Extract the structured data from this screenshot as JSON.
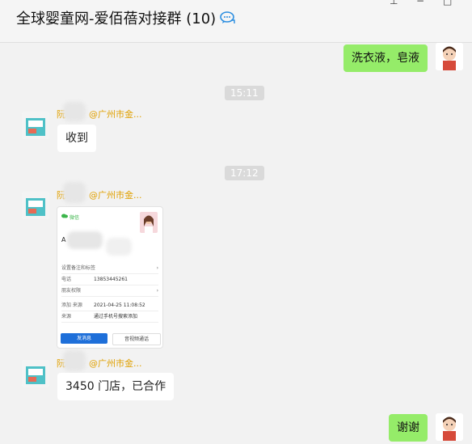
{
  "header": {
    "title": "全球婴童网-爱佰蓓对接群 (10)"
  },
  "window": {
    "pin": "⊥",
    "minimize": "−",
    "maximize": "□"
  },
  "messages": {
    "m1": {
      "text": "洗衣液，皂液"
    },
    "ts1": "15:11",
    "m2": {
      "sender_initial": "阮",
      "sender_tag": "@广州市金...",
      "text": "收到"
    },
    "ts2": "17:12",
    "m3": {
      "sender_initial": "阮",
      "sender_tag": "@广州市金..."
    },
    "m4": {
      "sender_initial": "阮",
      "sender_tag": "@广州市金...",
      "text": "3450  门店，已合作"
    },
    "m5": {
      "text": "谢谢"
    }
  },
  "card": {
    "app": "微信",
    "initial": "A",
    "row1": "设置备注和标签",
    "row2_label": "电话",
    "row2_value": "13853445261",
    "row3": "朋友权限",
    "row4_label": "添加  来源",
    "row4_value": "2021-04-25  11:08:52",
    "row5_label": "来源",
    "row5_value": "通过手机号搜索添加",
    "btn_primary": "发消息",
    "btn_secondary": "音视频通话"
  },
  "colors": {
    "accent_green": "#95ec69",
    "sender_tag": "#e0a000",
    "card_button": "#1e6fd9"
  }
}
